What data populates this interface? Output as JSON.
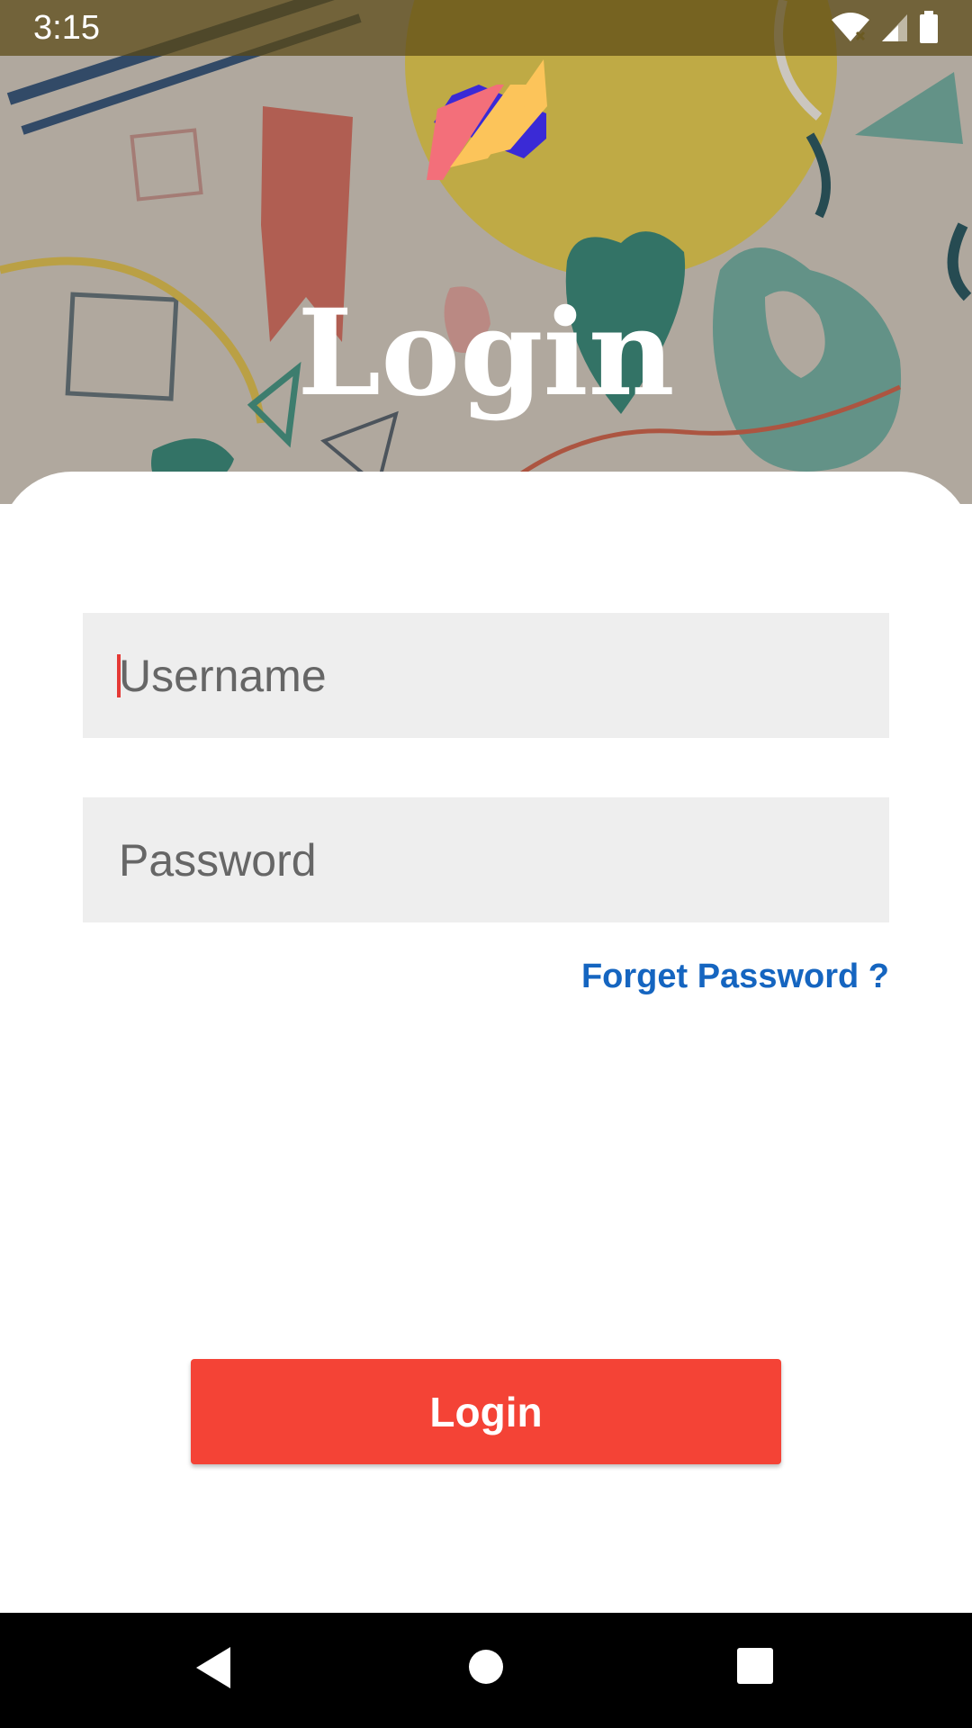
{
  "status_bar": {
    "time": "3:15",
    "icons": [
      "wifi-icon",
      "signal-icon",
      "battery-icon"
    ]
  },
  "hero": {
    "title": "Login",
    "logo": "app-logo"
  },
  "form": {
    "username_placeholder": "Username",
    "password_placeholder": "Password",
    "forgot_label": "Forget Password ?",
    "login_label": "Login"
  },
  "nav_bar": {
    "icons": [
      "back-icon",
      "home-icon",
      "recents-icon"
    ]
  },
  "colors": {
    "accent": "#f44336",
    "link": "#1565c0",
    "field_bg": "#eeeeee"
  }
}
